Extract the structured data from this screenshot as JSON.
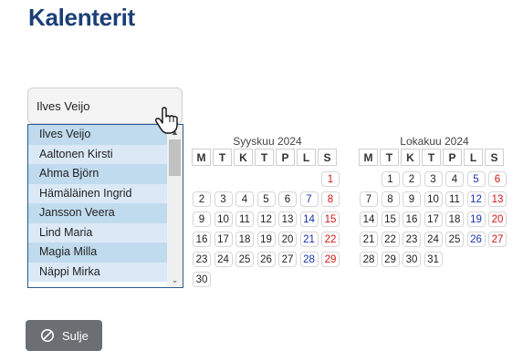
{
  "page": {
    "title": "Kalenterit"
  },
  "person_select": {
    "value": "Ilves Veijo",
    "options": [
      "Ilves Veijo",
      "Aaltonen Kirsti",
      "Ahma Björn",
      "Hämäläinen Ingrid",
      "Jansson Veera",
      "Lind Maria",
      "Magia Milla",
      "Näppi Mirka"
    ]
  },
  "calendar": {
    "weekdays": [
      "M",
      "T",
      "K",
      "T",
      "P",
      "L",
      "S"
    ],
    "months": [
      {
        "title": "Syyskuu 2024",
        "offset": 6,
        "days": 30
      },
      {
        "title": "Lokakuu 2024",
        "offset": 1,
        "days": 31
      }
    ]
  },
  "footer": {
    "close_label": "Sulje",
    "close_icon": "prohibit-icon"
  },
  "colors": {
    "title": "#1b3f76",
    "saturday": "#1a33b0",
    "sunday": "#d01818",
    "button": "#6b6f73"
  }
}
